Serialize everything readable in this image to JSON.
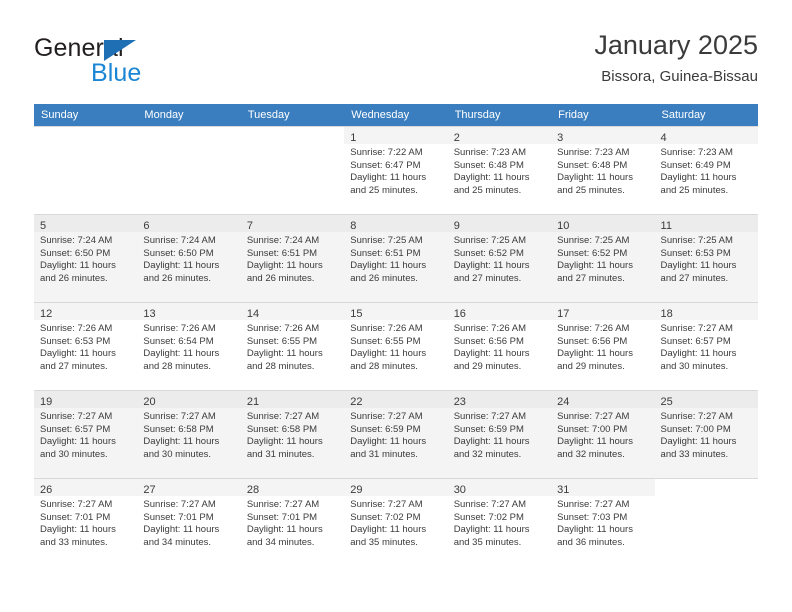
{
  "brand": {
    "name_part1": "General",
    "name_part2": "Blue",
    "triangle_color": "#1f6fb5",
    "blue_color": "#1b86d4"
  },
  "header": {
    "title": "January 2025",
    "location": "Bissora, Guinea-Bissau"
  },
  "theme": {
    "header_row_bg": "#3a7ebf",
    "alt_row_bg": "#f4f4f4",
    "daynum_bar_bg": "#f4f4f4",
    "text_color": "#3b3b3b",
    "border_color": "#d9d9d9"
  },
  "weekday_headers": [
    "Sunday",
    "Monday",
    "Tuesday",
    "Wednesday",
    "Thursday",
    "Friday",
    "Saturday"
  ],
  "weeks": [
    [
      {
        "day": "",
        "lines": []
      },
      {
        "day": "",
        "lines": []
      },
      {
        "day": "",
        "lines": []
      },
      {
        "day": "1",
        "lines": [
          "Sunrise: 7:22 AM",
          "Sunset: 6:47 PM",
          "Daylight: 11 hours",
          "and 25 minutes."
        ]
      },
      {
        "day": "2",
        "lines": [
          "Sunrise: 7:23 AM",
          "Sunset: 6:48 PM",
          "Daylight: 11 hours",
          "and 25 minutes."
        ]
      },
      {
        "day": "3",
        "lines": [
          "Sunrise: 7:23 AM",
          "Sunset: 6:48 PM",
          "Daylight: 11 hours",
          "and 25 minutes."
        ]
      },
      {
        "day": "4",
        "lines": [
          "Sunrise: 7:23 AM",
          "Sunset: 6:49 PM",
          "Daylight: 11 hours",
          "and 25 minutes."
        ]
      }
    ],
    [
      {
        "day": "5",
        "lines": [
          "Sunrise: 7:24 AM",
          "Sunset: 6:50 PM",
          "Daylight: 11 hours",
          "and 26 minutes."
        ]
      },
      {
        "day": "6",
        "lines": [
          "Sunrise: 7:24 AM",
          "Sunset: 6:50 PM",
          "Daylight: 11 hours",
          "and 26 minutes."
        ]
      },
      {
        "day": "7",
        "lines": [
          "Sunrise: 7:24 AM",
          "Sunset: 6:51 PM",
          "Daylight: 11 hours",
          "and 26 minutes."
        ]
      },
      {
        "day": "8",
        "lines": [
          "Sunrise: 7:25 AM",
          "Sunset: 6:51 PM",
          "Daylight: 11 hours",
          "and 26 minutes."
        ]
      },
      {
        "day": "9",
        "lines": [
          "Sunrise: 7:25 AM",
          "Sunset: 6:52 PM",
          "Daylight: 11 hours",
          "and 27 minutes."
        ]
      },
      {
        "day": "10",
        "lines": [
          "Sunrise: 7:25 AM",
          "Sunset: 6:52 PM",
          "Daylight: 11 hours",
          "and 27 minutes."
        ]
      },
      {
        "day": "11",
        "lines": [
          "Sunrise: 7:25 AM",
          "Sunset: 6:53 PM",
          "Daylight: 11 hours",
          "and 27 minutes."
        ]
      }
    ],
    [
      {
        "day": "12",
        "lines": [
          "Sunrise: 7:26 AM",
          "Sunset: 6:53 PM",
          "Daylight: 11 hours",
          "and 27 minutes."
        ]
      },
      {
        "day": "13",
        "lines": [
          "Sunrise: 7:26 AM",
          "Sunset: 6:54 PM",
          "Daylight: 11 hours",
          "and 28 minutes."
        ]
      },
      {
        "day": "14",
        "lines": [
          "Sunrise: 7:26 AM",
          "Sunset: 6:55 PM",
          "Daylight: 11 hours",
          "and 28 minutes."
        ]
      },
      {
        "day": "15",
        "lines": [
          "Sunrise: 7:26 AM",
          "Sunset: 6:55 PM",
          "Daylight: 11 hours",
          "and 28 minutes."
        ]
      },
      {
        "day": "16",
        "lines": [
          "Sunrise: 7:26 AM",
          "Sunset: 6:56 PM",
          "Daylight: 11 hours",
          "and 29 minutes."
        ]
      },
      {
        "day": "17",
        "lines": [
          "Sunrise: 7:26 AM",
          "Sunset: 6:56 PM",
          "Daylight: 11 hours",
          "and 29 minutes."
        ]
      },
      {
        "day": "18",
        "lines": [
          "Sunrise: 7:27 AM",
          "Sunset: 6:57 PM",
          "Daylight: 11 hours",
          "and 30 minutes."
        ]
      }
    ],
    [
      {
        "day": "19",
        "lines": [
          "Sunrise: 7:27 AM",
          "Sunset: 6:57 PM",
          "Daylight: 11 hours",
          "and 30 minutes."
        ]
      },
      {
        "day": "20",
        "lines": [
          "Sunrise: 7:27 AM",
          "Sunset: 6:58 PM",
          "Daylight: 11 hours",
          "and 30 minutes."
        ]
      },
      {
        "day": "21",
        "lines": [
          "Sunrise: 7:27 AM",
          "Sunset: 6:58 PM",
          "Daylight: 11 hours",
          "and 31 minutes."
        ]
      },
      {
        "day": "22",
        "lines": [
          "Sunrise: 7:27 AM",
          "Sunset: 6:59 PM",
          "Daylight: 11 hours",
          "and 31 minutes."
        ]
      },
      {
        "day": "23",
        "lines": [
          "Sunrise: 7:27 AM",
          "Sunset: 6:59 PM",
          "Daylight: 11 hours",
          "and 32 minutes."
        ]
      },
      {
        "day": "24",
        "lines": [
          "Sunrise: 7:27 AM",
          "Sunset: 7:00 PM",
          "Daylight: 11 hours",
          "and 32 minutes."
        ]
      },
      {
        "day": "25",
        "lines": [
          "Sunrise: 7:27 AM",
          "Sunset: 7:00 PM",
          "Daylight: 11 hours",
          "and 33 minutes."
        ]
      }
    ],
    [
      {
        "day": "26",
        "lines": [
          "Sunrise: 7:27 AM",
          "Sunset: 7:01 PM",
          "Daylight: 11 hours",
          "and 33 minutes."
        ]
      },
      {
        "day": "27",
        "lines": [
          "Sunrise: 7:27 AM",
          "Sunset: 7:01 PM",
          "Daylight: 11 hours",
          "and 34 minutes."
        ]
      },
      {
        "day": "28",
        "lines": [
          "Sunrise: 7:27 AM",
          "Sunset: 7:01 PM",
          "Daylight: 11 hours",
          "and 34 minutes."
        ]
      },
      {
        "day": "29",
        "lines": [
          "Sunrise: 7:27 AM",
          "Sunset: 7:02 PM",
          "Daylight: 11 hours",
          "and 35 minutes."
        ]
      },
      {
        "day": "30",
        "lines": [
          "Sunrise: 7:27 AM",
          "Sunset: 7:02 PM",
          "Daylight: 11 hours",
          "and 35 minutes."
        ]
      },
      {
        "day": "31",
        "lines": [
          "Sunrise: 7:27 AM",
          "Sunset: 7:03 PM",
          "Daylight: 11 hours",
          "and 36 minutes."
        ]
      },
      {
        "day": "",
        "lines": []
      }
    ]
  ]
}
